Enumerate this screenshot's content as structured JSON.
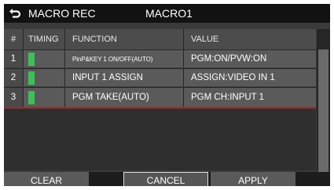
{
  "header": {
    "back_icon": "return-arrow-icon",
    "title": "MACRO REC",
    "macro_name": "MACRO1"
  },
  "table": {
    "columns": [
      "#",
      "TIMING",
      "FUNCTION",
      "VALUE"
    ],
    "rows": [
      {
        "no": "1",
        "function": "PinP&KEY 1 ON/OFF(AUTO)",
        "value": "PGM:ON/PVW:ON"
      },
      {
        "no": "2",
        "function": "INPUT 1 ASSIGN",
        "value": "ASSIGN:VIDEO IN 1"
      },
      {
        "no": "3",
        "function": "PGM TAKE(AUTO)",
        "value": "PGM CH:INPUT 1"
      }
    ],
    "timing_color": "#3fbf58",
    "selected_row_color": "#c41d1d"
  },
  "buttons": {
    "clear": "CLEAR",
    "cancel": "CANCEL",
    "apply": "APPLY"
  }
}
